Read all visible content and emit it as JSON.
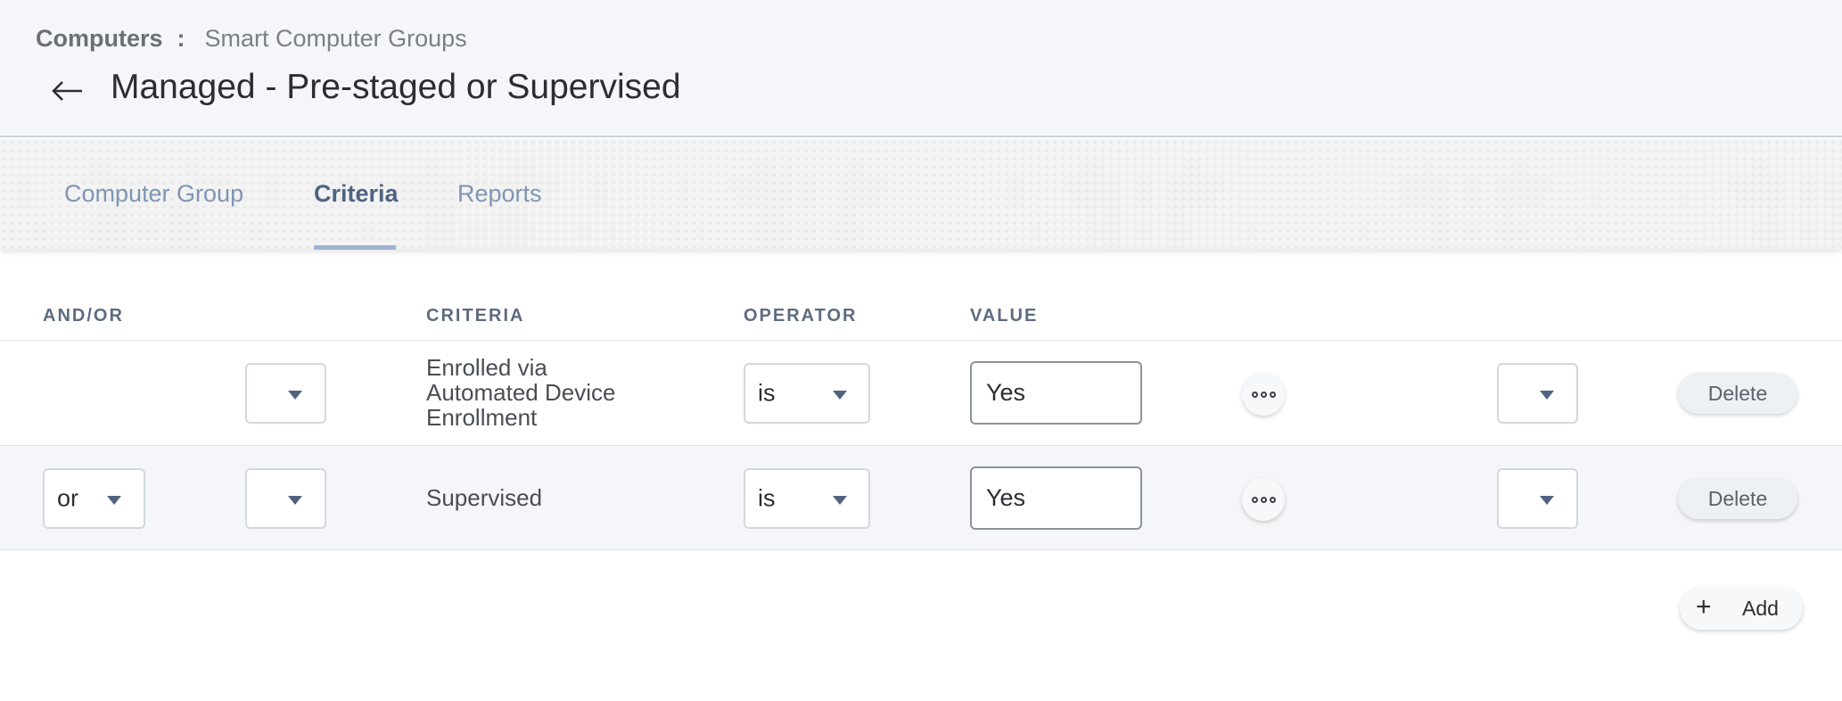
{
  "breadcrumb": {
    "root": "Computers",
    "separator": ":",
    "current": "Smart Computer Groups"
  },
  "page": {
    "title": "Managed - Pre-staged or Supervised",
    "back_icon": "arrow-left-icon"
  },
  "tabs": [
    {
      "label": "Computer Group",
      "active": false
    },
    {
      "label": "Criteria",
      "active": true
    },
    {
      "label": "Reports",
      "active": false
    }
  ],
  "columns": {
    "and_or": "AND/OR",
    "criteria": "CRITERIA",
    "operator": "OPERATOR",
    "value": "VALUE"
  },
  "rows": [
    {
      "and_or": "",
      "open_paren": "",
      "criteria": [
        "Enrolled via",
        "Automated Device",
        "Enrollment"
      ],
      "operator": "is",
      "value": "Yes",
      "close_paren": "",
      "delete_label": "Delete"
    },
    {
      "and_or": "or",
      "open_paren": "",
      "criteria": [
        "Supervised"
      ],
      "operator": "is",
      "value": "Yes",
      "close_paren": "",
      "delete_label": "Delete"
    }
  ],
  "actions": {
    "add_label": "Add",
    "add_icon": "+"
  },
  "colors": {
    "accent": "#4f6381",
    "tab_inactive": "#7f95b3",
    "tab_underline": "#9fb4d2"
  }
}
